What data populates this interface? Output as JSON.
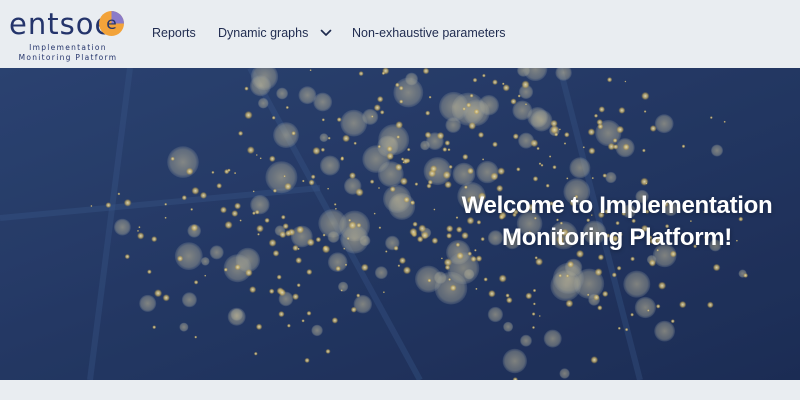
{
  "brand": {
    "name": "entsoe",
    "subtitle_line1": "Implementation",
    "subtitle_line2": "Monitoring Platform",
    "colors": {
      "navy": "#24346b",
      "orange": "#f2a33a",
      "purple": "#8a7bc9"
    }
  },
  "nav": {
    "items": [
      {
        "label": "Reports"
      },
      {
        "label": "Dynamic graphs",
        "icon": "chevron-down-icon"
      },
      {
        "label": "Non-exhaustive parameters"
      }
    ]
  },
  "hero": {
    "title_line1": "Welcome to Implementation",
    "title_line2": "Monitoring Platform!",
    "background": "night-map-lights",
    "colors": {
      "sky": "#1b2c52",
      "light": "#f3d77a"
    }
  }
}
